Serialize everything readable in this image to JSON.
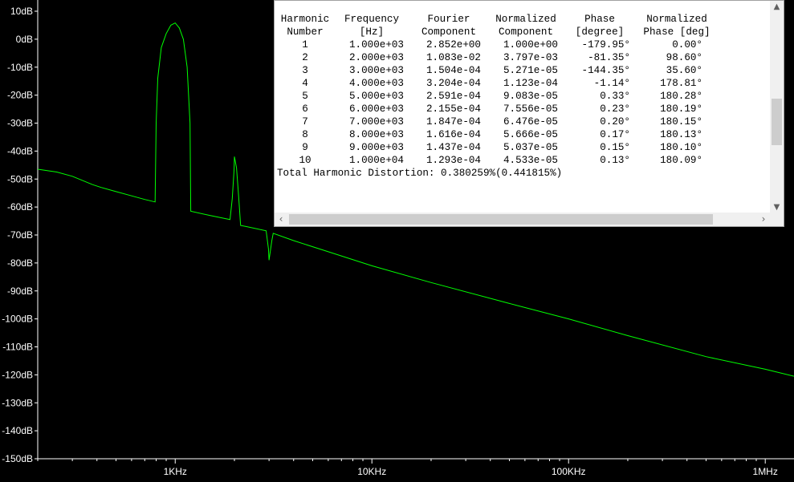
{
  "chart_data": {
    "type": "line",
    "xscale": "log",
    "xlim": [
      200,
      1400000
    ],
    "ylim": [
      -150,
      10
    ],
    "xlabel": "",
    "ylabel": "",
    "y_ticks": [
      "10dB",
      "0dB",
      "-10dB",
      "-20dB",
      "-30dB",
      "-40dB",
      "-50dB",
      "-60dB",
      "-70dB",
      "-80dB",
      "-90dB",
      "-100dB",
      "-110dB",
      "-120dB",
      "-130dB",
      "-140dB",
      "-150dB"
    ],
    "x_ticks": [
      {
        "label": "1KHz",
        "value": 1000
      },
      {
        "label": "10KHz",
        "value": 10000
      },
      {
        "label": "100KHz",
        "value": 100000
      },
      {
        "label": "1MHz",
        "value": 1000000
      }
    ],
    "grid": false,
    "series": [
      {
        "color": "#00ff00",
        "x": [
          200,
          250,
          300,
          380,
          420,
          500,
          600,
          700,
          790,
          800,
          815,
          850,
          900,
          950,
          1000,
          1050,
          1100,
          1150,
          1190,
          1200,
          1500,
          1900,
          1950,
          1990,
          2000,
          2050,
          2100,
          2150,
          2300,
          2900,
          2980,
          3000,
          3100,
          3150,
          4000,
          6000,
          10000,
          20000,
          50000,
          100000,
          200000,
          500000,
          1000000,
          1400000
        ],
        "y": [
          -46.5,
          -47.5,
          -49,
          -52,
          -53,
          -54.5,
          -56,
          -57.3,
          -58.2,
          -30,
          -14,
          -3,
          2,
          5,
          5.8,
          4,
          0,
          -10,
          -30,
          -61.5,
          -63,
          -64.5,
          -57,
          -47,
          -42,
          -46,
          -56,
          -66.6,
          -67,
          -68.5,
          -75,
          -79,
          -72,
          -69.4,
          -72,
          -76,
          -81,
          -87,
          -94.5,
          -100,
          -106,
          -113.5,
          -118,
          -120.5
        ]
      }
    ]
  },
  "fourier": {
    "headers": [
      {
        "line1": "Harmonic",
        "line2": "Number"
      },
      {
        "line1": "Frequency",
        "line2": "[Hz]"
      },
      {
        "line1": "Fourier",
        "line2": "Component"
      },
      {
        "line1": "Normalized",
        "line2": "Component"
      },
      {
        "line1": "Phase",
        "line2": "[degree]"
      },
      {
        "line1": "Normalized",
        "line2": "Phase [deg]"
      }
    ],
    "rows": [
      {
        "n": "1",
        "freq": "1.000e+03",
        "fc": "2.852e+00",
        "nc": "1.000e+00",
        "ph": "-179.95°",
        "nph": "0.00°"
      },
      {
        "n": "2",
        "freq": "2.000e+03",
        "fc": "1.083e-02",
        "nc": "3.797e-03",
        "ph": "-81.35°",
        "nph": "98.60°"
      },
      {
        "n": "3",
        "freq": "3.000e+03",
        "fc": "1.504e-04",
        "nc": "5.271e-05",
        "ph": "-144.35°",
        "nph": "35.60°"
      },
      {
        "n": "4",
        "freq": "4.000e+03",
        "fc": "3.204e-04",
        "nc": "1.123e-04",
        "ph": "-1.14°",
        "nph": "178.81°"
      },
      {
        "n": "5",
        "freq": "5.000e+03",
        "fc": "2.591e-04",
        "nc": "9.083e-05",
        "ph": "0.33°",
        "nph": "180.28°"
      },
      {
        "n": "6",
        "freq": "6.000e+03",
        "fc": "2.155e-04",
        "nc": "7.556e-05",
        "ph": "0.23°",
        "nph": "180.19°"
      },
      {
        "n": "7",
        "freq": "7.000e+03",
        "fc": "1.847e-04",
        "nc": "6.476e-05",
        "ph": "0.20°",
        "nph": "180.15°"
      },
      {
        "n": "8",
        "freq": "8.000e+03",
        "fc": "1.616e-04",
        "nc": "5.666e-05",
        "ph": "0.17°",
        "nph": "180.13°"
      },
      {
        "n": "9",
        "freq": "9.000e+03",
        "fc": "1.437e-04",
        "nc": "5.037e-05",
        "ph": "0.15°",
        "nph": "180.10°"
      },
      {
        "n": "10",
        "freq": "1.000e+04",
        "fc": "1.293e-04",
        "nc": "4.533e-05",
        "ph": "0.13°",
        "nph": "180.09°"
      }
    ],
    "thd": "Total Harmonic Distortion: 0.380259%(0.441815%)",
    "scroll_up_icon": "chevron-up-icon",
    "scroll_down_icon": "chevron-down-icon",
    "scroll_left_icon": "chevron-left-icon",
    "scroll_right_icon": "chevron-right-icon"
  },
  "colors": {
    "background": "#000000",
    "trace": "#00ff00",
    "axis": "#ffffff"
  }
}
